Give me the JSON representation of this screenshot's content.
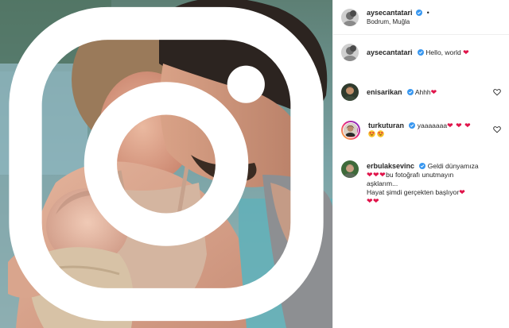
{
  "post": {
    "author": {
      "username": "aysecantatari",
      "location": "Bodrum, Muğla",
      "verified": true
    },
    "caption": {
      "username": "aysecantatari",
      "text": "Hello, world",
      "trailing_emoji": "❤"
    },
    "comments": [
      {
        "username": "enisarikan",
        "text": "Ahhh",
        "trailing_emoji": "❤"
      },
      {
        "username": "turkuturan",
        "text": "yaaaaaaa",
        "trailing_emoji": "❤ ❤ ❤",
        "second_line_emoji": "heart-eyes-face heart-eyes-face"
      },
      {
        "username": "erbulaksevinc",
        "line1": "Geldi dünyamıza",
        "line2_hearts": "❤❤❤",
        "line2_text": "bu fotoğrafı unutmayın",
        "line3": "aşklarım...",
        "line4": "Hayat şimdi gerçekten başlıyor",
        "line4_emoji": "❤",
        "line5_emoji": "❤❤"
      }
    ]
  },
  "colors": {
    "heart": "#e0144a",
    "verified": "#3897f0",
    "text": "#262626",
    "border": "#efefef"
  },
  "icons": {
    "watermark": "instagram-logo-icon",
    "like": "heart-outline-icon"
  }
}
